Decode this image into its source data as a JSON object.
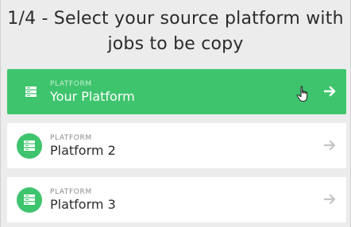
{
  "header": {
    "title_line1": "1/4 - Select your source platform with",
    "title_line2": "jobs to be copy"
  },
  "platforms": [
    {
      "caption": "PLATFORM",
      "name": "Your Platform",
      "selected": true,
      "icon": "server-icon",
      "action_icon": "arrow-right-icon"
    },
    {
      "caption": "PLATFORM",
      "name": "Platform 2",
      "selected": false,
      "icon": "server-icon",
      "action_icon": "arrow-right-icon"
    },
    {
      "caption": "PLATFORM",
      "name": "Platform 3",
      "selected": false,
      "icon": "server-icon",
      "action_icon": "arrow-right-icon"
    }
  ],
  "colors": {
    "accent": "#3ec46d",
    "background": "#ececec",
    "card": "#ffffff",
    "arrow_inactive": "#c4c4c4"
  }
}
